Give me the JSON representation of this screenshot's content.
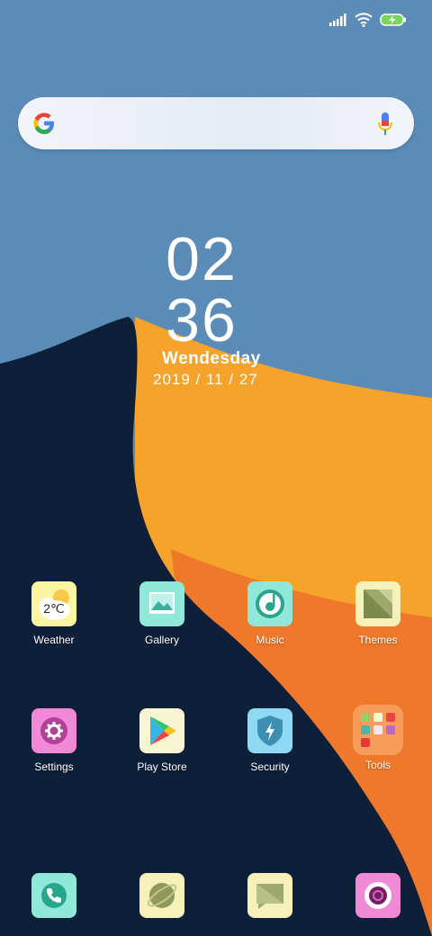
{
  "clock": {
    "hour": "02",
    "minute": "36",
    "day": "Wendesday",
    "date": "2019 /  11 /  27"
  },
  "weather_widget_temp": "2℃",
  "apps": [
    {
      "label": "Weather",
      "icon": "weather-icon"
    },
    {
      "label": "Gallery",
      "icon": "gallery-icon"
    },
    {
      "label": "Music",
      "icon": "music-icon"
    },
    {
      "label": "Themes",
      "icon": "themes-icon"
    },
    {
      "label": "Settings",
      "icon": "settings-icon"
    },
    {
      "label": "Play Store",
      "icon": "play-store-icon"
    },
    {
      "label": "Security",
      "icon": "security-icon"
    },
    {
      "label": "Tools",
      "icon": "tools-folder-icon"
    }
  ],
  "dock": [
    {
      "icon": "phone-icon"
    },
    {
      "icon": "browser-icon"
    },
    {
      "icon": "messages-icon"
    },
    {
      "icon": "camera-icon"
    }
  ],
  "colors": {
    "sky": "#5b8cb8",
    "dark": "#0e1f3a",
    "orange": "#f5a32b",
    "deep_orange": "#f0782a"
  }
}
